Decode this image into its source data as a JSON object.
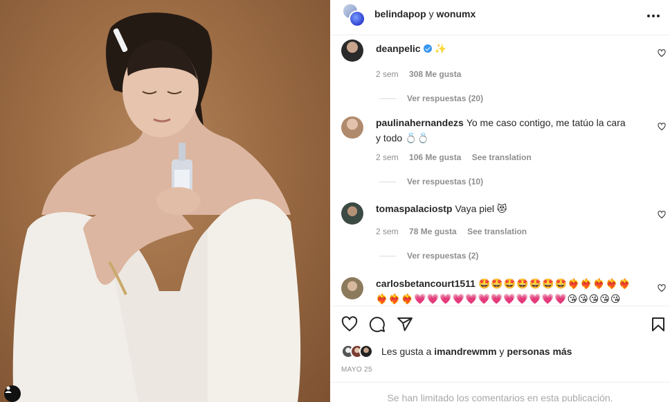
{
  "header": {
    "user1": "belindapop",
    "conjunction": "y",
    "user2": "wonumx"
  },
  "comments": [
    {
      "username": "deanpelic",
      "verified": true,
      "text": "✨",
      "time": "2 sem",
      "likes": "308 Me gusta",
      "translation": "",
      "replies": "Ver respuestas (20)"
    },
    {
      "username": "paulinahernandezs",
      "verified": false,
      "text": "Yo me caso contigo, me tatúo la cara y todo 💍💍",
      "time": "2 sem",
      "likes": "106 Me gusta",
      "translation": "See translation",
      "replies": "Ver respuestas (10)"
    },
    {
      "username": "tomaspalaciostp",
      "verified": false,
      "text": "Vaya piel 😻",
      "time": "2 sem",
      "likes": "78 Me gusta",
      "translation": "See translation",
      "replies": "Ver respuestas (2)"
    },
    {
      "username": "carlosbetancourt1511",
      "verified": false,
      "text": "🤩🤩🤩🤩🤩🤩🤩❤️‍🔥❤️‍🔥❤️‍🔥❤️‍🔥❤️‍🔥❤️‍🔥❤️‍🔥❤️‍🔥💗💗💗💗💗💗💗💗💗💗💗💗😘😘😘😘😘😘😘"
    }
  ],
  "likes_line": {
    "prefix": "Les gusta a",
    "user": "imandrewmm",
    "conjunction": "y",
    "others": "personas más"
  },
  "date": "MAYO 25",
  "limited_notice": "Se han limitado los comentarios en esta publicación.",
  "icons": [
    "more-options-icon",
    "heart-icon",
    "comment-icon",
    "share-icon",
    "bookmark-icon",
    "verified-badge-icon",
    "user-tag-icon"
  ],
  "colors": {
    "accent": "#3897f0",
    "text": "#262626",
    "muted": "#8e8e8e",
    "photo_bg": "#9c6c44"
  }
}
